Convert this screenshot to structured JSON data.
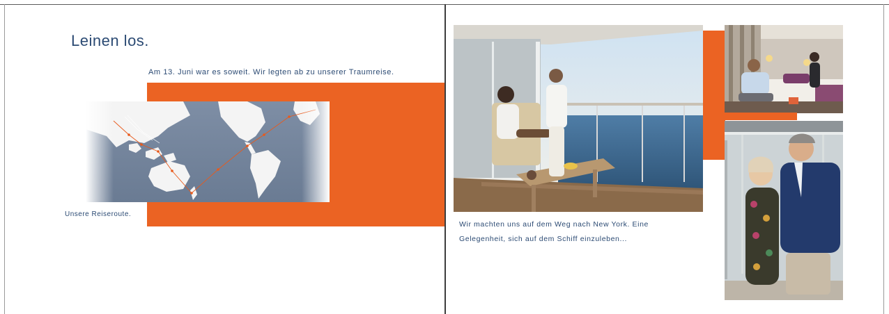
{
  "left_page": {
    "title": "Leinen los.",
    "subtitle": "Am 13. Juni war es soweit. Wir legten ab zu unserer Traumreise.",
    "map_caption": "Unsere Reiseroute."
  },
  "right_page": {
    "caption_line1": "Wir machten uns auf dem Weg nach New York. Eine",
    "caption_line2": "Gelegenheit, sich auf dem Schiff einzuleben..."
  },
  "colors": {
    "accent_orange": "#eb6323",
    "text_navy": "#2b4a73"
  }
}
